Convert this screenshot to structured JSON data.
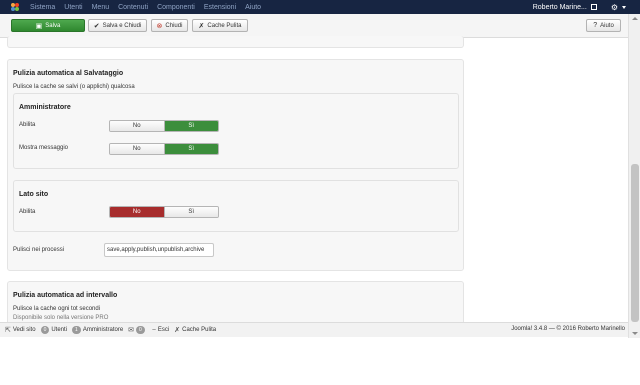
{
  "topnav": {
    "items": [
      "Sistema",
      "Utenti",
      "Menu",
      "Contenuti",
      "Componenti",
      "Estensioni",
      "Aiuto"
    ],
    "user": "Roberto Marine..."
  },
  "toolbar": {
    "save": "Salva",
    "save_close": "Salva e Chiudi",
    "close": "Chiudi",
    "clear_cache": "Cache Pulita",
    "help": "Aiuto"
  },
  "autosave": {
    "title": "Pulizia automatica al Salvataggio",
    "desc": "Pulisce la cache se salvi (o applichi) qualcosa",
    "admin": {
      "title": "Amministratore",
      "enable_label": "Abilita",
      "enable_no": "No",
      "enable_yes": "Sì",
      "enable_value": "Sì",
      "message_label": "Mostra messaggio",
      "message_no": "No",
      "message_yes": "Sì",
      "message_value": "Sì"
    },
    "site": {
      "title": "Lato sito",
      "enable_label": "Abilita",
      "enable_no": "No",
      "enable_yes": "Sì",
      "enable_value": "No"
    },
    "processes_label": "Pulisci nei processi",
    "processes_value": "save,apply,publish,unpublish,archive"
  },
  "interval": {
    "title": "Pulizia automatica ad intervallo",
    "desc": "Pulisce la cache ogni tot secondi",
    "note": "Disponibile solo nella versione PRO"
  },
  "statusbar": {
    "view_site": "Vedi sito",
    "users_count": "0",
    "users_label": "Utenti",
    "admins_count": "1",
    "admins_label": "Amministratore",
    "messages_count": "0",
    "logout": "Esci",
    "clear_cache": "Cache Pulita",
    "footer": "Joomla! 3.4.8 — © 2016 Roberto Marinello"
  },
  "colors": {
    "navbar": "#172542",
    "save_green": "#3c8e3c",
    "no_red": "#a72d2d"
  }
}
